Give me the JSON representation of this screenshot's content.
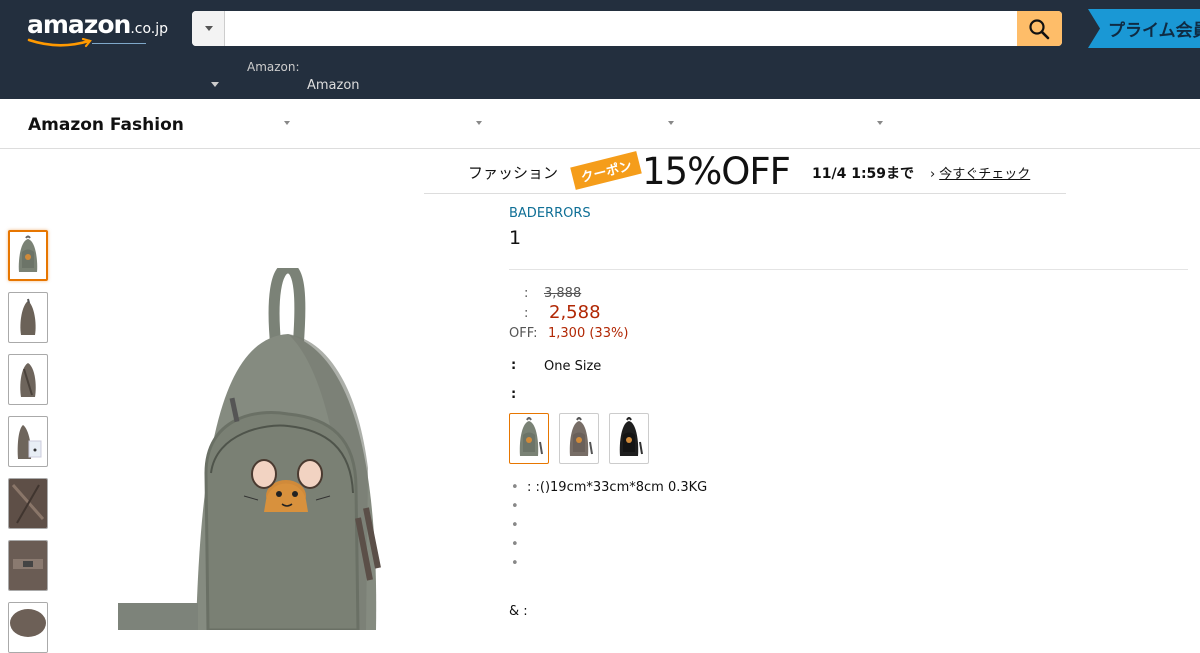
{
  "header": {
    "logo": {
      "word": "amazon",
      "tld": ".co.jp"
    },
    "search": {
      "value": "",
      "placeholder": ""
    },
    "prime_label": "プライム会員",
    "nav_label_1": "Amazon:",
    "nav_label_2": "Amazon"
  },
  "subnav": {
    "title": "Amazon Fashion"
  },
  "promo": {
    "category": "ファッション",
    "coupon": "クーポン",
    "discount": "15%OFF",
    "deadline": "11/4 1:59まで",
    "link_chevron": "›",
    "link": "今すぐチェック"
  },
  "product": {
    "brand": "BADERRORS",
    "title": "1",
    "list_price_colon": ":",
    "list_price": "3,888",
    "sale_price_colon": ":",
    "sale_price": "2,588",
    "off_label": "OFF:",
    "off_value": "1,300 (33%)",
    "size_colon": ":",
    "size_value": "One Size",
    "color_colon": ":",
    "bullets": [
      ": :()19cm*33cm*8cm 0.3KG",
      "",
      "",
      "",
      ""
    ],
    "footer_text": "& :"
  },
  "colors": {
    "nav_bg": "#232f3e",
    "search_button": "#febd69",
    "prime_banner": "#1a98d5",
    "price_red": "#b12704",
    "brand_link": "#0f6f96",
    "selected_border": "#e77600",
    "coupon_orange": "#f59d1a"
  }
}
